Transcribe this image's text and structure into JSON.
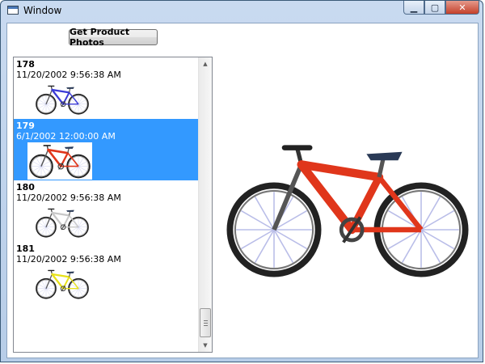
{
  "window": {
    "title": "Window",
    "icon": "window-icon"
  },
  "caption_buttons": [
    "minimize-icon",
    "maximize-icon",
    "close-icon"
  ],
  "toolbar": {
    "get_photos_label": "Get Product Photos"
  },
  "photos": [
    {
      "id": "178",
      "date": "11/20/2002 9:56:38 AM",
      "frame_color": "#3b3bd6",
      "selected": false
    },
    {
      "id": "179",
      "date": "6/1/2002 12:00:00 AM",
      "frame_color": "#e0361b",
      "selected": true
    },
    {
      "id": "180",
      "date": "11/20/2002 9:56:38 AM",
      "frame_color": "#c8c8c8",
      "selected": false
    },
    {
      "id": "181",
      "date": "11/20/2002 9:56:38 AM",
      "frame_color": "#e8e21a",
      "selected": false
    }
  ],
  "preview": {
    "frame_color": "#e0361b"
  },
  "colors": {
    "selection": "#3399ff"
  }
}
